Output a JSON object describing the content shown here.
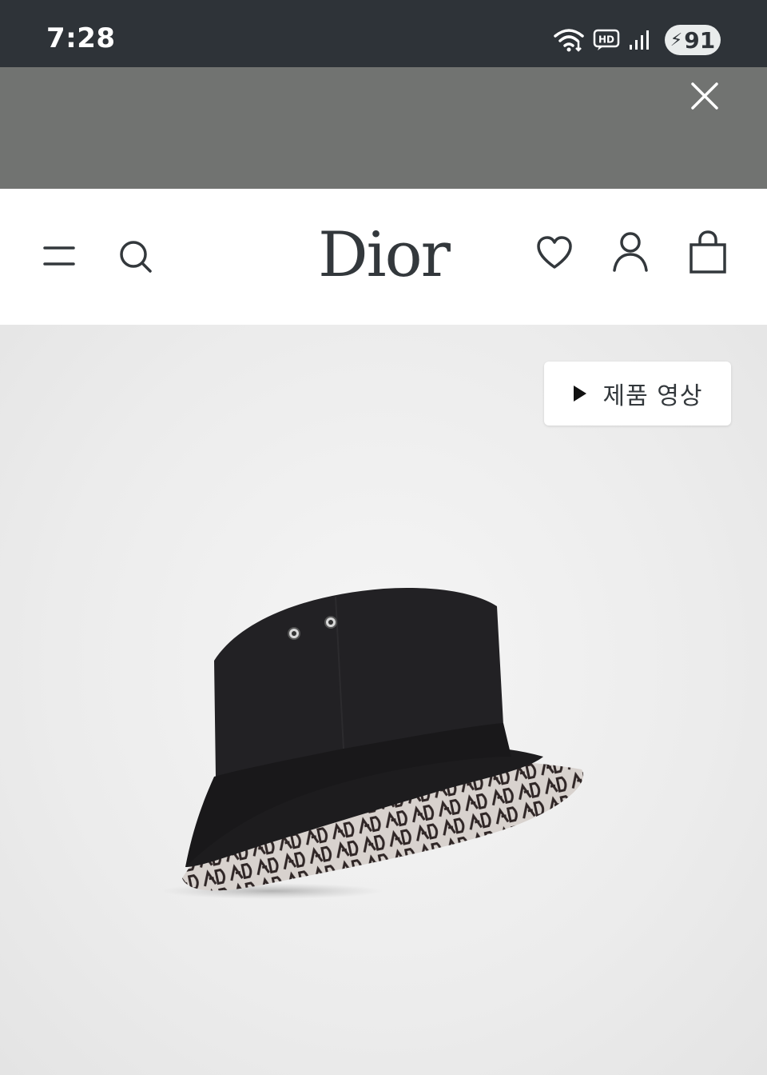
{
  "status_bar": {
    "time": "7:28",
    "battery_level": "91",
    "icons": [
      "wifi-icon",
      "hd-icon",
      "signal-icon",
      "battery-charging-icon"
    ]
  },
  "ad_banner": {
    "close_icon": "close-icon"
  },
  "header": {
    "logo_text": "Dior",
    "icons": [
      "menu-icon",
      "search-icon",
      "heart-icon",
      "account-icon",
      "shopping-bag-icon"
    ]
  },
  "product": {
    "video_button_label": "제품 영상",
    "video_icon": "play-icon"
  },
  "colors": {
    "status_bar_bg": "#2e3338",
    "banner_bg": "#717371",
    "icon_color": "#33383c",
    "product_bg": "#ececec"
  }
}
